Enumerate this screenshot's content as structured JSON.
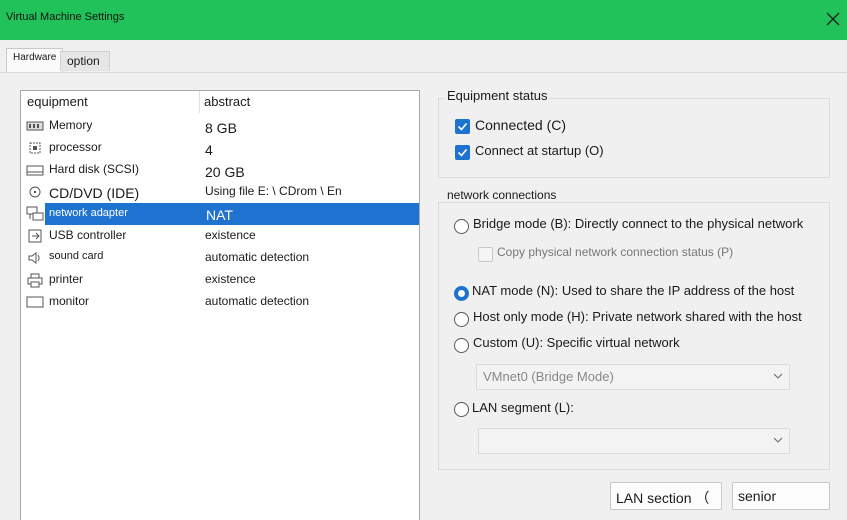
{
  "window": {
    "title": "Virtual Machine Settings"
  },
  "tabs": {
    "hardware": "Hardware",
    "option": "option"
  },
  "device_list": {
    "columns": [
      "equipment",
      "abstract"
    ],
    "rows": [
      {
        "icon": "memory-icon",
        "device": "Memory",
        "summary": "8 GB"
      },
      {
        "icon": "processor-icon",
        "device": "processor",
        "summary": "4"
      },
      {
        "icon": "hard-disk-icon",
        "device": "Hard disk (SCSI)",
        "summary": "20 GB"
      },
      {
        "icon": "cd-dvd-icon",
        "device": "CD/DVD (IDE)",
        "summary": "Using file E: \\ CDrom \\ En"
      },
      {
        "icon": "network-adapter-icon",
        "device": "network adapter",
        "summary": "NAT",
        "selected": true
      },
      {
        "icon": "usb-icon",
        "device": "USB controller",
        "summary": "existence"
      },
      {
        "icon": "sound-card-icon",
        "device": "sound card",
        "summary": "automatic detection"
      },
      {
        "icon": "printer-icon",
        "device": "printer",
        "summary": "existence"
      },
      {
        "icon": "monitor-icon",
        "device": "monitor",
        "summary": "automatic detection"
      }
    ]
  },
  "equipment_status": {
    "title": "Equipment status",
    "connected": {
      "label": "Connected (C)",
      "checked": true
    },
    "connect_at_startup": {
      "label": "Connect at startup (O)",
      "checked": true
    }
  },
  "network_connections": {
    "title": "network connections",
    "bridge": {
      "label": "Bridge mode (B): Directly connect to the physical network",
      "selected": false
    },
    "copy_status": {
      "label": "Copy physical network connection status (P)",
      "checked": false
    },
    "nat": {
      "label": "NAT mode (N): Used to share the IP address of the host",
      "selected": true
    },
    "host_only": {
      "label": "Host only mode (H): Private network shared with the host",
      "selected": false
    },
    "custom": {
      "label": "Custom (U): Specific virtual network",
      "selected": false
    },
    "vmnet_select": {
      "value": "VMnet0 (Bridge Mode)"
    },
    "lan_segment": {
      "label": "LAN segment (L):",
      "selected": false
    },
    "lan_segment_select": {
      "value": ""
    }
  },
  "buttons": {
    "lan_section": "LAN section （",
    "senior": "senior"
  },
  "colors": {
    "titlebar": "#22c25a",
    "accent": "#1e73d0"
  }
}
